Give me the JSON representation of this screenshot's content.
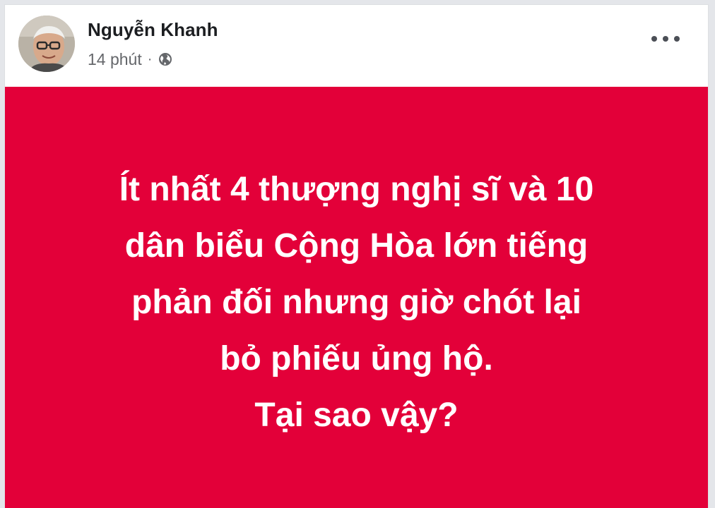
{
  "post": {
    "author": "Nguyễn Khanh",
    "time": "14 phút",
    "separator": "·",
    "privacy_icon": "globe-icon",
    "more_icon": "more-options-icon",
    "background_color": "#e30039",
    "text_color": "#ffffff",
    "lines": [
      "Ít nhất 4 thượng nghị sĩ và 10",
      "dân biểu Cộng Hòa lớn tiếng",
      "phản đối nhưng giờ chót lại",
      "bỏ phiếu ủng hộ.",
      "Tại sao vậy?"
    ]
  }
}
